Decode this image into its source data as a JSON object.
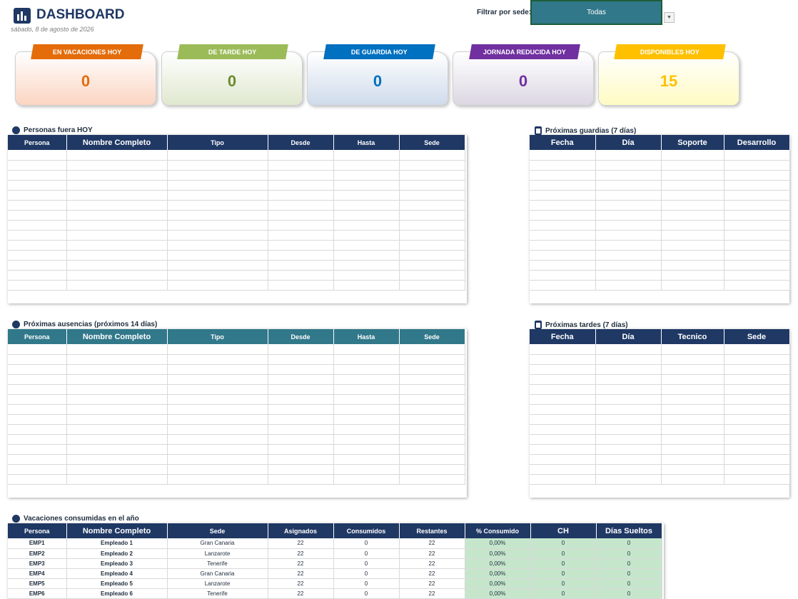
{
  "header": {
    "title": "DASHBOARD",
    "date": "sábado, 8 de agosto de 2026",
    "filter_label": "Filtrar por sede:",
    "filter_value": "Todas",
    "filter_icon": "chevron-down-icon"
  },
  "kpis": [
    {
      "label": "EN VACACIONES HOY",
      "value": "0",
      "tag_color": "#e46c0a",
      "value_color": "#e46c0a",
      "bg": "#fbd5c2"
    },
    {
      "label": "DE TARDE HOY",
      "value": "0",
      "tag_color": "#9bbb59",
      "value_color": "#6e8b2f",
      "bg": "#dfe8cf"
    },
    {
      "label": "DE GUARDIA HOY",
      "value": "0",
      "tag_color": "#0070c0",
      "value_color": "#0070c0",
      "bg": "#cfdbeb"
    },
    {
      "label": "JORNADA REDUCIDA HOY",
      "value": "0",
      "tag_color": "#7030a0",
      "value_color": "#7030a0",
      "bg": "#dcd7e2"
    },
    {
      "label": "DISPONIBLES HOY",
      "value": "15",
      "tag_color": "#ffc000",
      "value_color": "#ffc000",
      "bg": "#fffbc4"
    }
  ],
  "personas_fuera": {
    "heading": "Personas fuera HOY",
    "headers": [
      "Persona",
      "Nombre Completo",
      "Tipo",
      "Desde",
      "Hasta",
      "Sede"
    ]
  },
  "proximas_guardias": {
    "heading": "Próximas guardias (7 días)",
    "headers": [
      "Fecha",
      "Día",
      "Soporte",
      "Desarrollo"
    ]
  },
  "proximas_ausencias": {
    "heading": "Próximas ausencias (próximos 14 días)",
    "headers": [
      "Persona",
      "Nombre Completo",
      "Tipo",
      "Desde",
      "Hasta",
      "Sede"
    ]
  },
  "proximas_tardes": {
    "heading": "Próximas tardes (7 días)",
    "headers": [
      "Fecha",
      "Día",
      "Tecnico",
      "Sede"
    ]
  },
  "vacaciones": {
    "heading": "Vacaciones consumidas en el año",
    "headers": [
      "Persona",
      "Nombre Completo",
      "Sede",
      "Asignados",
      "Consumidos",
      "Restantes",
      "% Consumido",
      "CH",
      "Días Sueltos"
    ],
    "rows": [
      [
        "EMP1",
        "Empleado 1",
        "Gran Canaria",
        "22",
        "0",
        "22",
        "0,00%",
        "0",
        "0"
      ],
      [
        "EMP2",
        "Empleado 2",
        "Lanzarote",
        "22",
        "0",
        "22",
        "0,00%",
        "0",
        "0"
      ],
      [
        "EMP3",
        "Empleado 3",
        "Tenerife",
        "22",
        "0",
        "22",
        "0,00%",
        "0",
        "0"
      ],
      [
        "EMP4",
        "Empleado 4",
        "Gran Canaria",
        "22",
        "0",
        "22",
        "0,00%",
        "0",
        "0"
      ],
      [
        "EMP5",
        "Empleado 5",
        "Lanzarote",
        "22",
        "0",
        "22",
        "0,00%",
        "0",
        "0"
      ],
      [
        "EMP6",
        "Empleado 6",
        "Tenerife",
        "22",
        "0",
        "22",
        "0,00%",
        "0",
        "0"
      ]
    ]
  }
}
